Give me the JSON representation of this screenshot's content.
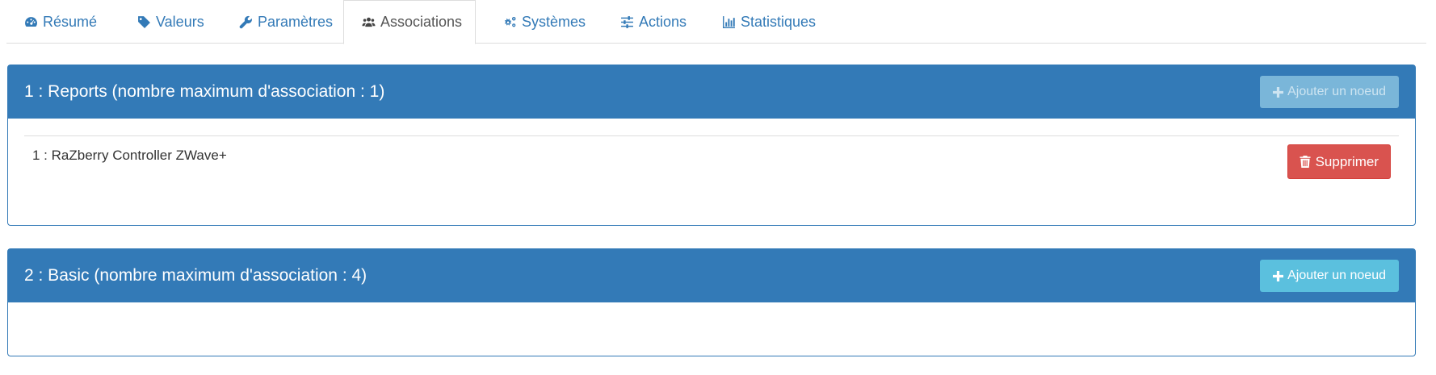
{
  "tabs": [
    {
      "label": "Résumé",
      "icon": "dashboard-icon"
    },
    {
      "label": "Valeurs",
      "icon": "tag-icon"
    },
    {
      "label": "Paramètres",
      "icon": "wrench-icon"
    },
    {
      "label": "Associations",
      "icon": "users-icon",
      "active": true
    },
    {
      "label": "Systèmes",
      "icon": "cogs-icon"
    },
    {
      "label": "Actions",
      "icon": "sliders-icon"
    },
    {
      "label": "Statistiques",
      "icon": "bar-chart-icon"
    }
  ],
  "groups": [
    {
      "title": "1 : Reports (nombre maximum d'association : 1)",
      "add_label": "Ajouter un noeud",
      "add_disabled": true,
      "nodes": [
        {
          "label": "1 : RaZberry Controller ZWave+",
          "delete_label": "Supprimer"
        }
      ]
    },
    {
      "title": "2 : Basic (nombre maximum d'association : 4)",
      "add_label": "Ajouter un noeud",
      "add_disabled": false,
      "nodes": []
    }
  ],
  "colors": {
    "primary": "#337ab7",
    "info": "#5bc0de",
    "danger": "#d9534f"
  }
}
